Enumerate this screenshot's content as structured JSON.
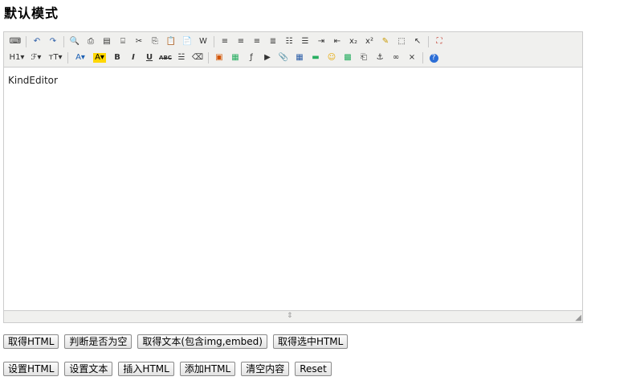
{
  "page": {
    "title": "默认模式"
  },
  "toolbar": {
    "row1": [
      {
        "icon": "source-icon",
        "glyph": "⌨"
      },
      {
        "sep": true
      },
      {
        "icon": "undo-icon",
        "glyph": "↶",
        "color": "#2c5ea8"
      },
      {
        "icon": "redo-icon",
        "glyph": "↷",
        "color": "#2c5ea8"
      },
      {
        "sep": true
      },
      {
        "icon": "preview-icon",
        "glyph": "🔍"
      },
      {
        "icon": "print-icon",
        "glyph": "⎙"
      },
      {
        "icon": "template-icon",
        "glyph": "▤"
      },
      {
        "icon": "code-icon",
        "glyph": "⌸"
      },
      {
        "icon": "cut-icon",
        "glyph": "✂"
      },
      {
        "icon": "copy-icon",
        "glyph": "⎘"
      },
      {
        "icon": "paste-icon",
        "glyph": "📋"
      },
      {
        "icon": "paste-plain-icon",
        "glyph": "📄"
      },
      {
        "icon": "paste-word-icon",
        "glyph": "W"
      },
      {
        "sep": true
      },
      {
        "icon": "align-left-icon",
        "glyph": "≡"
      },
      {
        "icon": "align-center-icon",
        "glyph": "≡"
      },
      {
        "icon": "align-right-icon",
        "glyph": "≡"
      },
      {
        "icon": "align-justify-icon",
        "glyph": "≣"
      },
      {
        "icon": "ordered-list-icon",
        "glyph": "☷"
      },
      {
        "icon": "unordered-list-icon",
        "glyph": "☰"
      },
      {
        "icon": "indent-icon",
        "glyph": "⇥"
      },
      {
        "icon": "outdent-icon",
        "glyph": "⇤"
      },
      {
        "icon": "subscript-icon",
        "glyph": "x₂"
      },
      {
        "icon": "superscript-icon",
        "glyph": "x²"
      },
      {
        "icon": "clear-format-icon",
        "glyph": "✎",
        "color": "#c99a00"
      },
      {
        "icon": "select-all-icon",
        "glyph": "⬚"
      },
      {
        "icon": "pointer-icon",
        "glyph": "↖"
      },
      {
        "sep": true
      },
      {
        "icon": "fullscreen-icon",
        "glyph": "⛶",
        "color": "#c0392b"
      }
    ],
    "row2": [
      {
        "icon": "heading-icon",
        "glyph": "H1▾",
        "wide": true
      },
      {
        "icon": "font-family-icon",
        "glyph": "ℱ▾",
        "wide": true
      },
      {
        "icon": "font-size-icon",
        "glyph": "тT▾",
        "wide": true
      },
      {
        "sep": true
      },
      {
        "icon": "text-color-icon",
        "glyph": "A▾",
        "color": "#1a5fb4",
        "wide": true
      },
      {
        "icon": "highlight-color-icon",
        "glyph": "A▾",
        "color": "#000",
        "bg": "#ffd700",
        "wide": true
      },
      {
        "icon": "bold-icon",
        "glyph": "B",
        "bold": true
      },
      {
        "icon": "italic-icon",
        "glyph": "I",
        "italic": true
      },
      {
        "icon": "underline-icon",
        "glyph": "U",
        "underline": true
      },
      {
        "icon": "strikethrough-icon",
        "glyph": "ABC"
      },
      {
        "icon": "line-height-icon",
        "glyph": "☱"
      },
      {
        "icon": "remove-format-icon",
        "glyph": "⌫"
      },
      {
        "sep": true
      },
      {
        "icon": "image-icon",
        "glyph": "▣",
        "color": "#d35400"
      },
      {
        "icon": "multi-image-icon",
        "glyph": "▦",
        "color": "#27ae60"
      },
      {
        "icon": "flash-icon",
        "glyph": "ƒ"
      },
      {
        "icon": "media-icon",
        "glyph": "▶"
      },
      {
        "icon": "attachment-icon",
        "glyph": "📎"
      },
      {
        "icon": "table-icon",
        "glyph": "▦",
        "color": "#2c5ea8"
      },
      {
        "icon": "hr-icon",
        "glyph": "▬",
        "color": "#27ae60"
      },
      {
        "icon": "emoticon-icon",
        "glyph": "☺",
        "color": "#e6a700"
      },
      {
        "icon": "baidu-map-icon",
        "glyph": "▩",
        "color": "#27ae60"
      },
      {
        "icon": "page-break-icon",
        "glyph": "⎗"
      },
      {
        "icon": "anchor-icon",
        "glyph": "⚓"
      },
      {
        "icon": "link-icon",
        "glyph": "∞"
      },
      {
        "icon": "unlink-icon",
        "glyph": "⨯"
      },
      {
        "sep": true
      },
      {
        "icon": "help-icon",
        "glyph": "?",
        "color": "#fff",
        "bg": "#2c6ed6",
        "round": true
      }
    ]
  },
  "editor": {
    "content": "KindEditor"
  },
  "buttons": {
    "row1": [
      "取得HTML",
      "判断是否为空",
      "取得文本(包含img,embed)",
      "取得选中HTML"
    ],
    "row2": [
      "设置HTML",
      "设置文本",
      "插入HTML",
      "添加HTML",
      "清空内容",
      "Reset"
    ]
  }
}
